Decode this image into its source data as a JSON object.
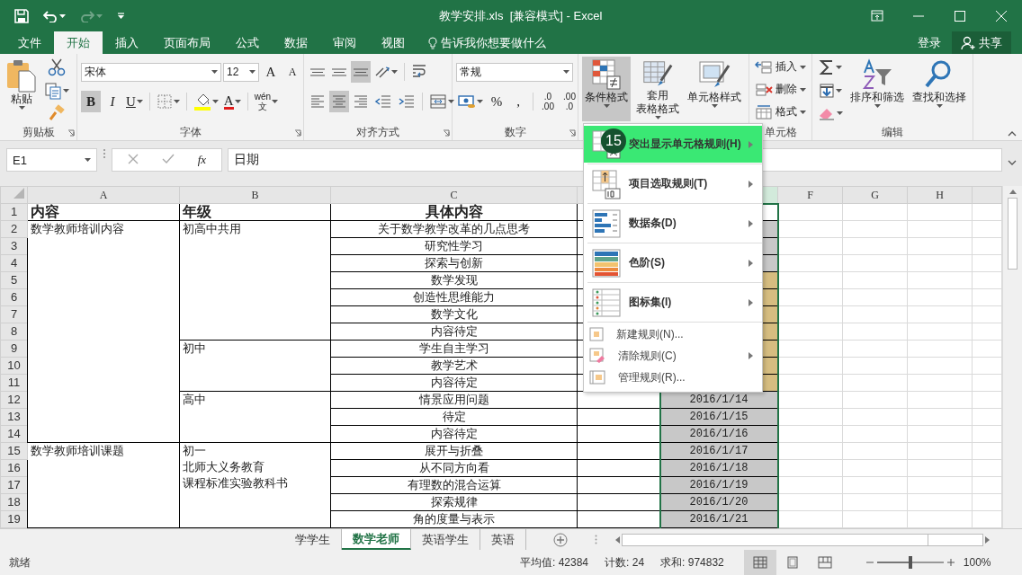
{
  "window": {
    "title": "教学安排.xls  [兼容模式] - Excel"
  },
  "quick_access": [
    {
      "kind": "save"
    },
    {
      "kind": "undo",
      "dropdown": true
    },
    {
      "kind": "redo",
      "disabled": true,
      "dropdown": true
    },
    {
      "kind": "customize"
    }
  ],
  "ribbon_tabs": [
    {
      "label": "文件",
      "selected": false
    },
    {
      "label": "开始",
      "selected": true
    },
    {
      "label": "插入",
      "selected": false
    },
    {
      "label": "页面布局",
      "selected": false
    },
    {
      "label": "公式",
      "selected": false
    },
    {
      "label": "数据",
      "selected": false
    },
    {
      "label": "审阅",
      "selected": false
    },
    {
      "label": "视图",
      "selected": false
    }
  ],
  "tell_me": "告诉我你想要做什么",
  "account": {
    "sign_in": "登录",
    "share": "共享"
  },
  "ribbon_groups": [
    {
      "kind": "clipboard",
      "label": "剪贴板",
      "launcher": true,
      "items": [
        {
          "kind": "paste",
          "label": "粘贴",
          "dropdown": true
        },
        {
          "kind": "cut"
        },
        {
          "kind": "copy",
          "dropdown": true
        },
        {
          "kind": "painter"
        }
      ]
    },
    {
      "kind": "font",
      "label": "字体",
      "launcher": true,
      "items": [
        {
          "kind": "font",
          "value": "宋体"
        },
        {
          "kind": "size",
          "value": "12"
        },
        {
          "kind": "grow",
          "glyph": "A"
        },
        {
          "kind": "shrink",
          "glyph": "A"
        },
        {
          "kind": "bold",
          "glyph": "B",
          "pressed": true
        },
        {
          "kind": "italic",
          "glyph": "I",
          "pressed": false
        },
        {
          "kind": "underline",
          "glyph": "U",
          "pressed": false,
          "dropdown": true
        },
        {
          "kind": "border",
          "dropdown": true
        },
        {
          "kind": "fill",
          "dropdown": true
        },
        {
          "kind": "color",
          "glyph": "A",
          "dropdown": true
        },
        {
          "kind": "phonetic",
          "glyph": "wén",
          "sub": "文",
          "dropdown": true
        }
      ]
    },
    {
      "kind": "alignment",
      "label": "对齐方式",
      "launcher": true,
      "items": [
        {
          "kind": "top",
          "pressed": false
        },
        {
          "kind": "middle",
          "pressed": false
        },
        {
          "kind": "bottom",
          "pressed": true
        },
        {
          "kind": "orient",
          "dropdown": true
        },
        {
          "kind": "wrap"
        },
        {
          "kind": "left",
          "pressed": false
        },
        {
          "kind": "center",
          "pressed": true
        },
        {
          "kind": "right",
          "pressed": false
        },
        {
          "kind": "outdent"
        },
        {
          "kind": "indent"
        },
        {
          "kind": "merge",
          "dropdown": true
        }
      ]
    },
    {
      "kind": "number",
      "label": "数字",
      "launcher": true,
      "items": [
        {
          "kind": "format",
          "value": "常规"
        },
        {
          "kind": "currency",
          "dropdown": true
        },
        {
          "kind": "percent",
          "glyph": "%"
        },
        {
          "kind": "comma",
          "glyph": ","
        },
        {
          "kind": "incdec",
          "glyph": ".0",
          "sub": ".00"
        },
        {
          "kind": "decdec",
          "glyph": ".00",
          "sub": ".0"
        }
      ]
    },
    {
      "kind": "styles",
      "items": [
        {
          "kind": "condfmt",
          "label": "条件格式",
          "dropdown": true,
          "pressed": true
        },
        {
          "kind": "tablefmt",
          "lines": [
            "套用",
            "表格格式"
          ],
          "dropdown": true,
          "pressed": false
        },
        {
          "kind": "cellstyle",
          "label": "单元格样式",
          "dropdown": true,
          "pressed": false
        }
      ]
    },
    {
      "kind": "cells",
      "label": "单元格",
      "items": [
        {
          "kind": "insert",
          "label": "插入",
          "dropdown": true
        },
        {
          "kind": "delete",
          "label": "删除",
          "dropdown": true
        },
        {
          "kind": "cellfmt",
          "label": "格式",
          "dropdown": true
        }
      ]
    },
    {
      "kind": "editing",
      "label": "编辑",
      "items": [
        {
          "kind": "sum",
          "dropdown": true
        },
        {
          "kind": "filldown",
          "dropdown": true
        },
        {
          "kind": "clear",
          "dropdown": true
        },
        {
          "kind": "sort",
          "label": "排序和筛选",
          "dropdown": true
        },
        {
          "kind": "find",
          "label": "查找和选择",
          "dropdown": true
        }
      ]
    }
  ],
  "formula_bar": {
    "name_box": "E1",
    "fx": "fx",
    "formula": "日期"
  },
  "sheet": {
    "columns": [
      {
        "label": "A",
        "selected": false
      },
      {
        "label": "B",
        "selected": false
      },
      {
        "label": "C",
        "selected": false
      },
      {
        "selected": false
      },
      {
        "selected": true
      },
      {
        "label": "F",
        "selected": false
      },
      {
        "label": "G",
        "selected": false
      },
      {
        "label": "H",
        "selected": false
      }
    ],
    "row_numbers": [
      "1",
      "2",
      "3",
      "4",
      "5",
      "6",
      "7",
      "8",
      "9",
      "10",
      "11",
      "12",
      "13",
      "14",
      "15",
      "16",
      "17",
      "18",
      "19"
    ],
    "header": {
      "content": "内容",
      "grade": "年级",
      "topic": "具体内容"
    },
    "sections": [
      {
        "content": "数学教师培训内容",
        "grades": [
          {
            "lines": [
              "初高中共用"
            ],
            "topics": [
              "关于数学教学改革的几点思考",
              "研究性学习",
              "探索与创新",
              "数学发现",
              "创造性思维能力",
              "数学文化",
              "内容待定"
            ]
          },
          {
            "lines": [
              "初中"
            ],
            "topics": [
              "学生自主学习",
              "教学艺术",
              "内容待定"
            ]
          },
          {
            "lines": [
              "高中"
            ],
            "topics": [
              "情景应用问题",
              "待定",
              "内容待定"
            ]
          }
        ]
      },
      {
        "content": "数学教师培训课题",
        "grades": [
          {
            "lines": [
              "初一",
              "北师大义务教育",
              "课程标准实验教科书"
            ],
            "topics": [
              "展开与折叠",
              "从不同方向看",
              "有理数的混合运算",
              "探索规律",
              "角的度量与表示"
            ]
          }
        ]
      }
    ],
    "column_e": [
      {
        "color": "#ffffff"
      },
      {
        "color": "#c8c8c8"
      },
      {
        "color": "#c8c8c8"
      },
      {
        "color": "#c8c8c8"
      },
      {
        "color": "#d6bd80"
      },
      {
        "color": "#d6bd80"
      },
      {
        "color": "#d6bd80"
      },
      {
        "color": "#d6bd80"
      },
      {
        "color": "#d6bd80"
      },
      {
        "color": "#d6bd80"
      },
      {
        "color": "#d6bd80"
      },
      {
        "color": "#c8c8c8",
        "text": "2016/1/14"
      },
      {
        "color": "#c8c8c8",
        "text": "2016/1/15"
      },
      {
        "color": "#c8c8c8",
        "text": "2016/1/16"
      },
      {
        "color": "#c8c8c8",
        "text": "2016/1/17"
      },
      {
        "color": "#c8c8c8",
        "text": "2016/1/18"
      },
      {
        "color": "#c8c8c8",
        "text": "2016/1/19"
      },
      {
        "color": "#c8c8c8",
        "text": "2016/1/20"
      },
      {
        "color": "#c8c8c8",
        "text": "2016/1/21"
      }
    ]
  },
  "menu": {
    "items": [
      {
        "kind": "highlight",
        "label": "突出显示单元格规则(H)",
        "highlighted": true,
        "submenu": true
      },
      {
        "kind": "topbottom",
        "label": "项目选取规则(T)",
        "highlighted": false,
        "submenu": true
      },
      {
        "kind": "databar",
        "label": "数据条(D)",
        "highlighted": false,
        "submenu": true
      },
      {
        "kind": "colorscale",
        "label": "色阶(S)",
        "highlighted": false,
        "submenu": true
      },
      {
        "kind": "iconset",
        "label": "图标集(I)",
        "highlighted": false,
        "submenu": true
      },
      {
        "kind": "newrule",
        "label": "新建规则(N)...",
        "highlighted": false
      },
      {
        "kind": "clearrules",
        "label": "清除规则(C)",
        "highlighted": false,
        "submenu": true
      },
      {
        "kind": "managerules",
        "label": "管理规则(R)...",
        "highlighted": false
      }
    ]
  },
  "step_badge": "15",
  "sheet_tabs": [
    {
      "label": "学学生",
      "selected": false
    },
    {
      "label": "数学老师",
      "selected": true
    },
    {
      "label": "英语学生",
      "selected": false
    },
    {
      "label": "英语",
      "selected": false
    }
  ],
  "status_bar": {
    "ready": "就绪",
    "average": "平均值: 42384",
    "count": "计数: 24",
    "sum": "求和: 974832",
    "views": [
      {
        "kind": "normal",
        "selected": true
      },
      {
        "kind": "layout",
        "selected": false
      },
      {
        "kind": "pagebreak",
        "selected": false
      }
    ],
    "zoom": {
      "level": 0.5,
      "reading": "100%"
    }
  }
}
